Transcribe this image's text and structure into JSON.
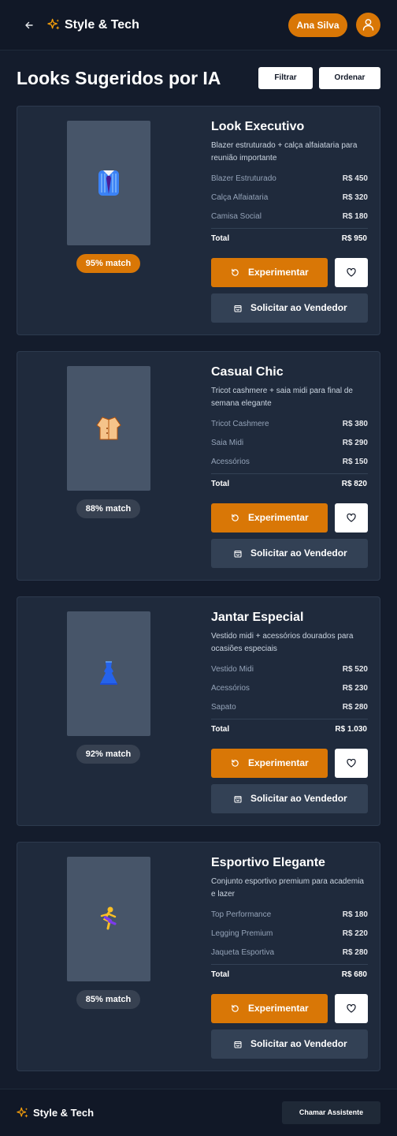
{
  "header": {
    "brand": "Style & Tech",
    "user_name": "Ana Silva"
  },
  "page": {
    "title": "Looks Sugeridos por IA",
    "filter_label": "Filtrar",
    "sort_label": "Ordenar"
  },
  "looks": [
    {
      "title": "Look Executivo",
      "description": "Blazer estruturado + calça alfaiataria para reunião importante",
      "emoji": "👔",
      "match": "95% match",
      "items": [
        {
          "name": "Blazer Estruturado",
          "price": "R$ 450"
        },
        {
          "name": "Calça Alfaiataria",
          "price": "R$ 320"
        },
        {
          "name": "Camisa Social",
          "price": "R$ 180"
        }
      ],
      "total_label": "Total",
      "total": "R$ 950",
      "try_label": "Experimentar",
      "request_label": "Solicitar ao Vendedor"
    },
    {
      "title": "Casual Chic",
      "description": "Tricot cashmere + saia midi para final de semana elegante",
      "emoji": "🧥",
      "match": "88% match",
      "items": [
        {
          "name": "Tricot Cashmere",
          "price": "R$ 380"
        },
        {
          "name": "Saia Midi",
          "price": "R$ 290"
        },
        {
          "name": "Acessórios",
          "price": "R$ 150"
        }
      ],
      "total_label": "Total",
      "total": "R$ 820",
      "try_label": "Experimentar",
      "request_label": "Solicitar ao Vendedor"
    },
    {
      "title": "Jantar Especial",
      "description": "Vestido midi + acessórios dourados para ocasiões especiais",
      "emoji": "👗",
      "match": "92% match",
      "items": [
        {
          "name": "Vestido Midi",
          "price": "R$ 520"
        },
        {
          "name": "Acessórios",
          "price": "R$ 230"
        },
        {
          "name": "Sapato",
          "price": "R$ 280"
        }
      ],
      "total_label": "Total",
      "total": "R$ 1.030",
      "try_label": "Experimentar",
      "request_label": "Solicitar ao Vendedor"
    },
    {
      "title": "Esportivo Elegante",
      "description": "Conjunto esportivo premium para academia e lazer",
      "emoji": "🏃",
      "match": "85% match",
      "items": [
        {
          "name": "Top Performance",
          "price": "R$ 180"
        },
        {
          "name": "Legging Premium",
          "price": "R$ 220"
        },
        {
          "name": "Jaqueta Esportiva",
          "price": "R$ 280"
        }
      ],
      "total_label": "Total",
      "total": "R$ 680",
      "try_label": "Experimentar",
      "request_label": "Solicitar ao Vendedor"
    }
  ],
  "footer": {
    "brand": "Style & Tech",
    "assistant_label": "Chamar Assistente"
  },
  "colors": {
    "accent": "#d97706",
    "background": "#141c2c",
    "card": "#1f2a3c"
  }
}
